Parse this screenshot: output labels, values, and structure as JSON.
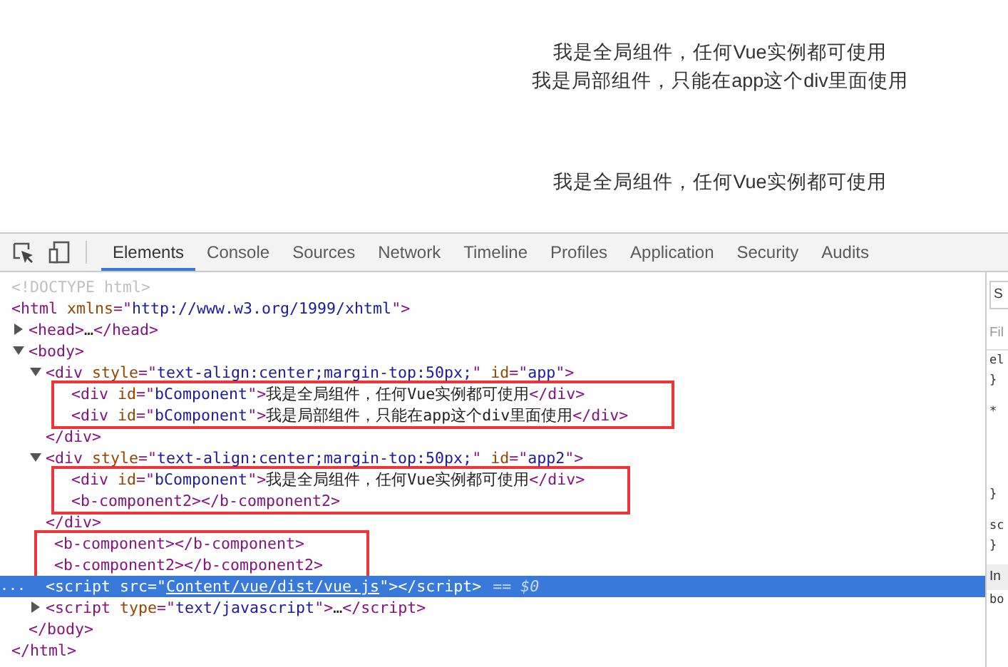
{
  "page": {
    "lines": [
      "我是全局组件，任何Vue实例都可使用",
      "我是局部组件，只能在app这个div里面使用",
      "我是全局组件，任何Vue实例都可使用"
    ]
  },
  "devtools": {
    "tabs": [
      {
        "label": "Elements",
        "selected": true
      },
      {
        "label": "Console",
        "selected": false
      },
      {
        "label": "Sources",
        "selected": false
      },
      {
        "label": "Network",
        "selected": false
      },
      {
        "label": "Timeline",
        "selected": false
      },
      {
        "label": "Profiles",
        "selected": false
      },
      {
        "label": "Application",
        "selected": false
      },
      {
        "label": "Security",
        "selected": false
      },
      {
        "label": "Audits",
        "selected": false
      }
    ],
    "dom": [
      {
        "selected": false,
        "tokens": [
          {
            "kind": "doctype",
            "t": "<!DOCTYPE html>"
          }
        ]
      },
      {
        "selected": false,
        "tokens": [
          {
            "kind": "tag",
            "t": "<html"
          },
          {
            "kind": "attr",
            "t": " xmlns"
          },
          {
            "kind": "tag",
            "t": "=\""
          },
          {
            "kind": "value",
            "t": "http://www.w3.org/1999/xhtml"
          },
          {
            "kind": "tag",
            "t": "\">"
          }
        ],
        "children": [
          {
            "selected": false,
            "expanded": false,
            "tokens": [
              {
                "kind": "tag",
                "t": "<head>"
              },
              {
                "kind": "text",
                "t": "…"
              },
              {
                "kind": "tag",
                "t": "</head>"
              }
            ]
          },
          {
            "selected": false,
            "expanded": true,
            "tokens": [
              {
                "kind": "tag",
                "t": "<body>"
              }
            ],
            "children": [
              {
                "selected": false,
                "boxed": false,
                "expanded": true,
                "tokens": [
                  {
                    "kind": "tag",
                    "t": "<div"
                  },
                  {
                    "kind": "attr",
                    "t": " style"
                  },
                  {
                    "kind": "tag",
                    "t": "=\""
                  },
                  {
                    "kind": "value",
                    "t": "text-align:center;margin-top:50px;"
                  },
                  {
                    "kind": "tag",
                    "t": "\""
                  },
                  {
                    "kind": "attr",
                    "t": " id"
                  },
                  {
                    "kind": "tag",
                    "t": "=\""
                  },
                  {
                    "kind": "value",
                    "t": "app"
                  },
                  {
                    "kind": "tag",
                    "t": "\">"
                  }
                ],
                "children": [
                  {
                    "selected": false,
                    "boxed": true,
                    "tokens": [
                      {
                        "kind": "tag",
                        "t": "<div"
                      },
                      {
                        "kind": "attr",
                        "t": " id"
                      },
                      {
                        "kind": "tag",
                        "t": "=\""
                      },
                      {
                        "kind": "value",
                        "t": "bComponent"
                      },
                      {
                        "kind": "tag",
                        "t": "\">"
                      },
                      {
                        "kind": "text",
                        "t": "我是全局组件，任何Vue实例都可使用"
                      },
                      {
                        "kind": "tag",
                        "t": "</div>"
                      }
                    ]
                  },
                  {
                    "selected": false,
                    "boxed": true,
                    "tokens": [
                      {
                        "kind": "tag",
                        "t": "<div"
                      },
                      {
                        "kind": "attr",
                        "t": " id"
                      },
                      {
                        "kind": "tag",
                        "t": "=\""
                      },
                      {
                        "kind": "value",
                        "t": "bComponent"
                      },
                      {
                        "kind": "tag",
                        "t": "\">"
                      },
                      {
                        "kind": "text",
                        "t": "我是局部组件，只能在app这个div里面使用"
                      },
                      {
                        "kind": "tag",
                        "t": "</div>"
                      }
                    ]
                  }
                ]
              },
              {
                "selected": false,
                "boxed": false,
                "tokens": [
                  {
                    "kind": "tag",
                    "t": "</div>"
                  }
                ]
              },
              {
                "selected": false,
                "boxed": false,
                "expanded": true,
                "tokens": [
                  {
                    "kind": "tag",
                    "t": "<div"
                  },
                  {
                    "kind": "attr",
                    "t": " style"
                  },
                  {
                    "kind": "tag",
                    "t": "=\""
                  },
                  {
                    "kind": "value",
                    "t": "text-align:center;margin-top:50px;"
                  },
                  {
                    "kind": "tag",
                    "t": "\""
                  },
                  {
                    "kind": "attr",
                    "t": " id"
                  },
                  {
                    "kind": "tag",
                    "t": "=\""
                  },
                  {
                    "kind": "value",
                    "t": "app2"
                  },
                  {
                    "kind": "tag",
                    "t": "\">"
                  }
                ],
                "children": [
                  {
                    "selected": false,
                    "boxed": true,
                    "tokens": [
                      {
                        "kind": "tag",
                        "t": "<div"
                      },
                      {
                        "kind": "attr",
                        "t": " id"
                      },
                      {
                        "kind": "tag",
                        "t": "=\""
                      },
                      {
                        "kind": "value",
                        "t": "bComponent"
                      },
                      {
                        "kind": "tag",
                        "t": "\">"
                      },
                      {
                        "kind": "text",
                        "t": "我是全局组件，任何Vue实例都可使用"
                      },
                      {
                        "kind": "tag",
                        "t": "</div>"
                      }
                    ]
                  },
                  {
                    "selected": false,
                    "boxed": true,
                    "tokens": [
                      {
                        "kind": "tag",
                        "t": "<b-component2></b-component2>"
                      }
                    ]
                  }
                ]
              },
              {
                "selected": false,
                "boxed": false,
                "tokens": [
                  {
                    "kind": "tag",
                    "t": "</div>"
                  }
                ]
              },
              {
                "selected": false,
                "boxed": true,
                "tokens": [
                  {
                    "kind": "tag",
                    "t": "<b-component></b-component>"
                  }
                ]
              },
              {
                "selected": false,
                "boxed": true,
                "tokens": [
                  {
                    "kind": "tag",
                    "t": "<b-component2></b-component2>"
                  }
                ]
              },
              {
                "selected": true,
                "boxed": false,
                "gutter": "...",
                "console_ref": "== $0",
                "tokens": [
                  {
                    "kind": "tag",
                    "t": "<script"
                  },
                  {
                    "kind": "attr",
                    "t": " src"
                  },
                  {
                    "kind": "tag",
                    "t": "=\""
                  },
                  {
                    "kind": "link",
                    "t": "Content/vue/dist/vue.js"
                  },
                  {
                    "kind": "tag",
                    "t": "\"></script>"
                  }
                ]
              },
              {
                "selected": false,
                "boxed": false,
                "expanded": false,
                "tokens": [
                  {
                    "kind": "tag",
                    "t": "<script"
                  },
                  {
                    "kind": "attr",
                    "t": " type"
                  },
                  {
                    "kind": "tag",
                    "t": "=\""
                  },
                  {
                    "kind": "value",
                    "t": "text/javascript"
                  },
                  {
                    "kind": "tag",
                    "t": "\">"
                  },
                  {
                    "kind": "text",
                    "t": "…"
                  },
                  {
                    "kind": "tag",
                    "t": "</script>"
                  }
                ]
              }
            ]
          },
          {
            "selected": false,
            "tokens": [
              {
                "kind": "tag",
                "t": "</body>"
              }
            ]
          }
        ]
      },
      {
        "selected": false,
        "tokens": [
          {
            "kind": "tag",
            "t": "</html>"
          }
        ]
      }
    ],
    "styles_pane": [
      {
        "kind": "tab",
        "text": "S"
      },
      {
        "kind": "filter",
        "text": "Fil"
      },
      {
        "kind": "code",
        "text": "el"
      },
      {
        "kind": "code",
        "text": "}"
      },
      {
        "kind": "rule",
        "text": "*"
      },
      {
        "kind": "gap",
        "text": "}"
      },
      {
        "kind": "rule",
        "text": "sc"
      },
      {
        "kind": "code",
        "text": "}"
      },
      {
        "kind": "heading",
        "text": "In"
      },
      {
        "kind": "code",
        "text": "bo"
      }
    ]
  }
}
